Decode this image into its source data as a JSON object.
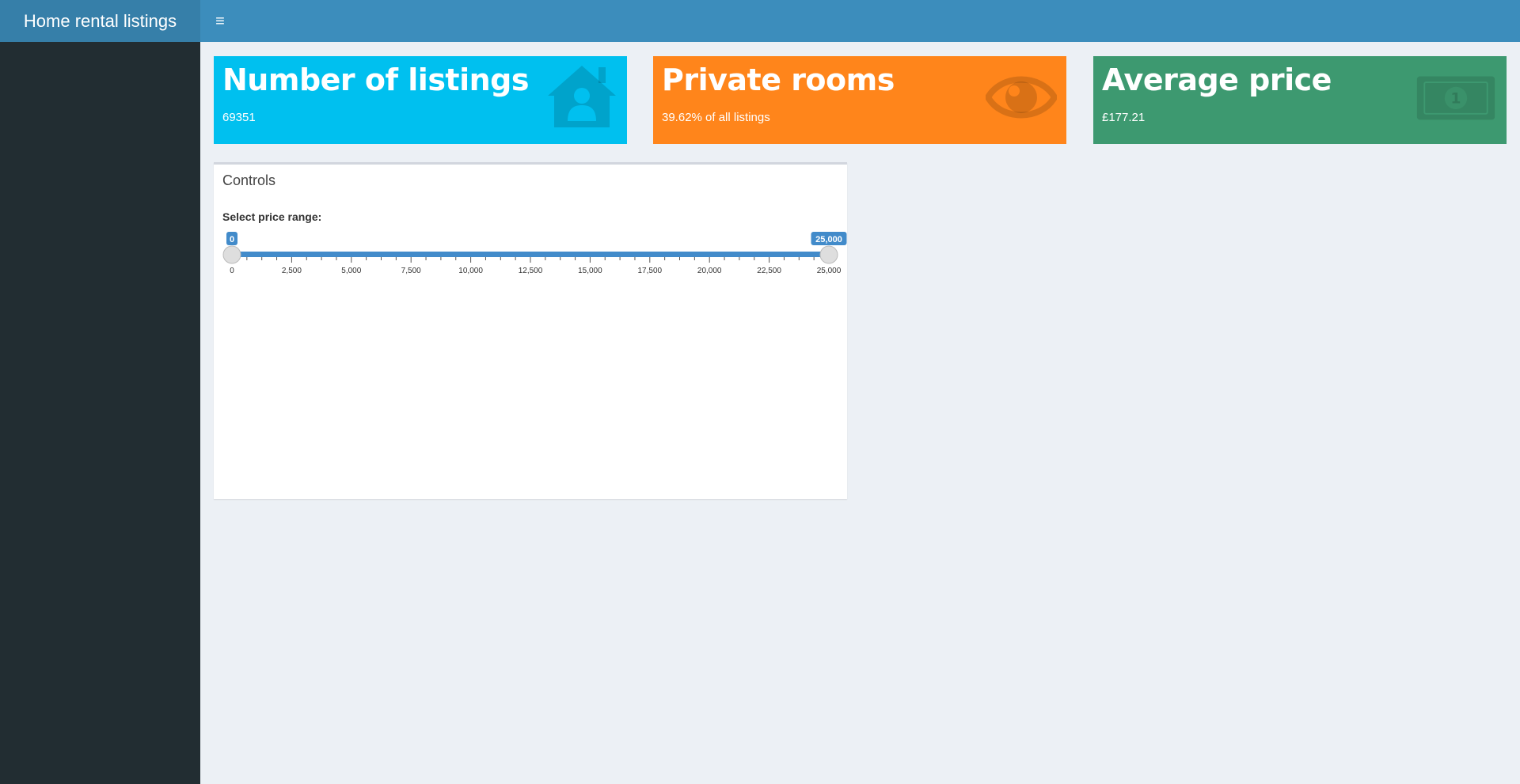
{
  "header": {
    "title": "Home rental listings",
    "toggle_glyph": "≡"
  },
  "colors": {
    "listings": "#00c0ef",
    "rooms": "#ff851b",
    "price": "#3d9970",
    "accent": "#428bca"
  },
  "valueboxes": [
    {
      "title": "Number of listings",
      "value": "69351",
      "icon": "house-user-icon"
    },
    {
      "title": "Private rooms",
      "value": "39.62% of all listings",
      "icon": "eye-icon"
    },
    {
      "title": "Average price",
      "value": "£177.21",
      "icon": "money-bill-icon"
    }
  ],
  "controls": {
    "title": "Controls",
    "slider": {
      "label": "Select price range:",
      "min": 0,
      "max": 25000,
      "from": 0,
      "to": 25000,
      "from_label": "0",
      "to_label": "25,000",
      "ticks": [
        "0",
        "2,500",
        "5,000",
        "7,500",
        "10,000",
        "12,500",
        "15,000",
        "17,500",
        "20,000",
        "22,500",
        "25,000"
      ]
    }
  }
}
